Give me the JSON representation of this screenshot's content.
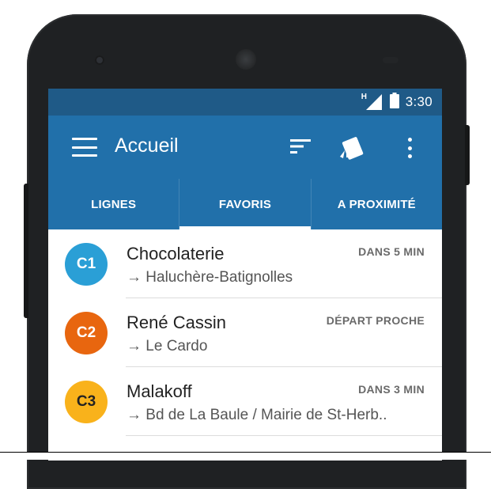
{
  "status_bar": {
    "network_label": "H",
    "time": "3:30"
  },
  "app_bar": {
    "title": "Accueil",
    "icons": [
      "menu-icon",
      "sort-icon",
      "card-icon",
      "more-vert-icon"
    ],
    "color": "#2170aa"
  },
  "tabs": [
    {
      "label": "LIGNES",
      "selected": false
    },
    {
      "label": "FAVORIS",
      "selected": true
    },
    {
      "label": "A PROXIMITÉ",
      "selected": false
    }
  ],
  "favorites": [
    {
      "line": "C1",
      "stop": "Chocolaterie",
      "destination": "→ Haluchère-Batignolles",
      "status": "DANS 5 MIN",
      "color": "#2a9fd6",
      "text_color": "#ffffff"
    },
    {
      "line": "C2",
      "stop": "René Cassin",
      "destination": "→ Le Cardo",
      "status": "DÉPART PROCHE",
      "color": "#e8660f",
      "text_color": "#ffffff"
    },
    {
      "line": "C3",
      "stop": "Malakoff",
      "destination": "→ Bd de La Baule / Mairie de St-Herb..",
      "status": "DANS 3 MIN",
      "color": "#f9b21b",
      "text_color": "#222222"
    }
  ]
}
